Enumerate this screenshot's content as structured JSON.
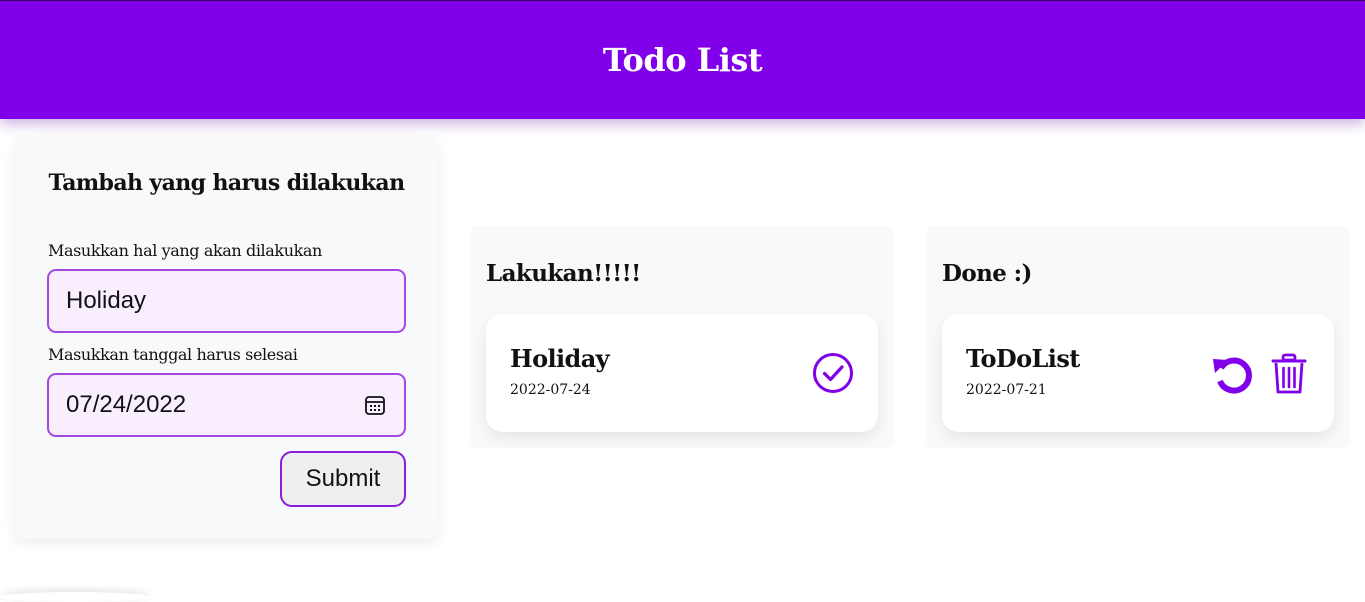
{
  "header": {
    "title": "Todo List"
  },
  "form": {
    "title": "Tambah yang harus dilakukan",
    "title_label": "Masukkan hal yang akan dilakukan",
    "title_value": "Holiday",
    "date_label": "Masukkan tanggal harus selesai",
    "date_value": "07/24/2022",
    "submit_label": "Submit"
  },
  "todo": {
    "title": "Lakukan!!!!!",
    "items": [
      {
        "title": "Holiday",
        "date": "2022-07-24"
      }
    ]
  },
  "done": {
    "title": "Done :)",
    "items": [
      {
        "title": "ToDoList",
        "date": "2022-07-21"
      }
    ]
  },
  "colors": {
    "accent": "#8000ea",
    "input_border": "#a349e0",
    "input_bg": "#f8eefe",
    "card_bg": "#f8f9fb"
  },
  "icons": {
    "calendar": "calendar-icon",
    "check": "check-circle-icon",
    "undo": "undo-icon",
    "trash": "trash-icon"
  }
}
